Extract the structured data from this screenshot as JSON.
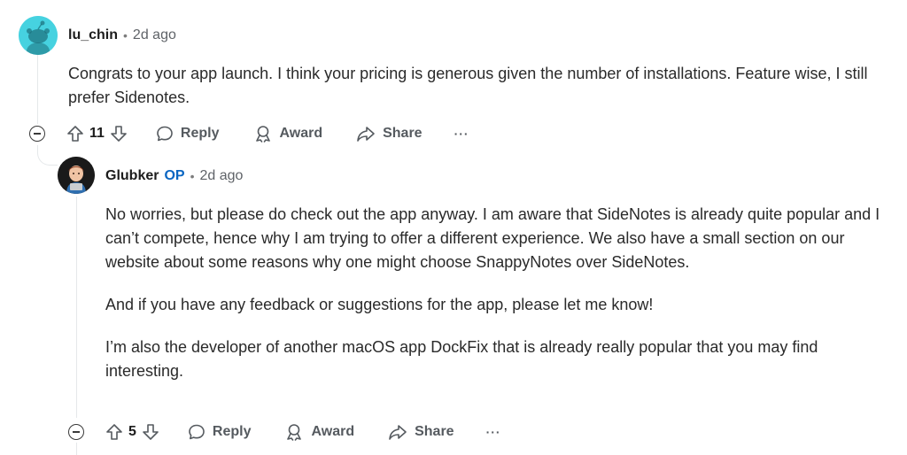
{
  "comments": [
    {
      "username": "lu_chin",
      "op_badge": "",
      "time": "2d ago",
      "paragraphs": [
        "Congrats to your app launch. I think your pricing is generous given the number of installations. Feature wise, I still prefer Sidenotes."
      ],
      "score": "11",
      "reply_label": "Reply",
      "award_label": "Award",
      "share_label": "Share",
      "more_label": "···"
    },
    {
      "username": "Glubker",
      "op_badge": "OP",
      "time": "2d ago",
      "paragraphs": [
        "No worries, but please do check out the app anyway. I am aware that SideNotes is already quite popular and I can’t compete, hence why I am trying to offer a different experience. We also have a small section on our website about some reasons why one might choose SnappyNotes over SideNotes.",
        "And if you have any feedback or suggestions for the app, please let me know!",
        "I’m also the developer of another macOS app DockFix that is already really popular that you may find interesting."
      ],
      "score": "5",
      "reply_label": "Reply",
      "award_label": "Award",
      "share_label": "Share",
      "more_label": "···"
    }
  ],
  "colors": {
    "accent_op": "#0a66c2",
    "avatar_1_bg": "#46d2e0",
    "avatar_2_bg": "#1a1a1a"
  }
}
